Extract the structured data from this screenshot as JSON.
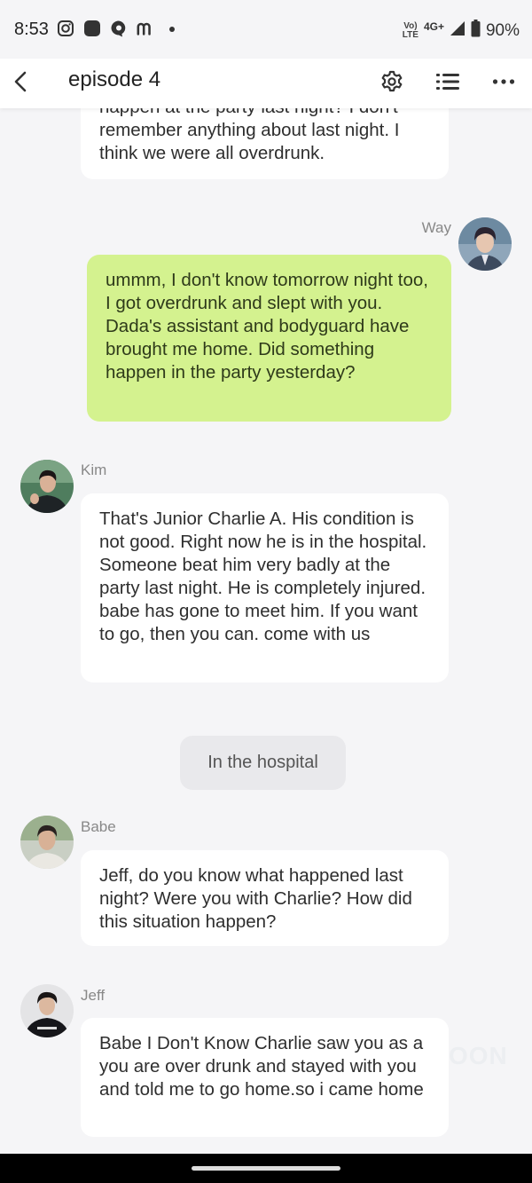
{
  "status_bar": {
    "time": "8:53",
    "network": "4G+",
    "volte_line1": "Vo)",
    "volte_line2": "LTE",
    "battery": "90%"
  },
  "app_bar": {
    "title": "episode 4",
    "icons": [
      "back-icon",
      "gear-icon",
      "list-icon",
      "more-icon"
    ]
  },
  "chat": {
    "partial_message": "happen at the party last night? I don't remember anything about last night. I think we were all overdrunk.",
    "msg_way": {
      "name": "Way",
      "text": "ummm, I don't know tomorrow night too, I got overdrunk and slept with you. Dada's assistant and bodyguard have brought me home. Did something happen in the party yesterday?"
    },
    "msg_kim": {
      "name": "Kim",
      "text": "That's Junior Charlie A. His condition is not good. Right now he is in the hospital. Someone beat him very badly at the party last night. He is completely injured. babe has gone to meet him. If you want to go, then you can. come with us"
    },
    "scene_label": "In the hospital",
    "msg_babe": {
      "name": "Babe",
      "text": "Jeff, do you know what happened last night? Were you with Charlie? How did this situation happen?"
    },
    "msg_jeff": {
      "name": "Jeff",
      "text": "Babe I Don't Know Charlie saw you as a you are over drunk and stayed with you and told me to go home.so i came home"
    }
  },
  "watermark": "OON",
  "colors": {
    "background": "#f5f5f7",
    "my_bubble": "#d4f28f",
    "other_bubble": "#ffffff"
  }
}
